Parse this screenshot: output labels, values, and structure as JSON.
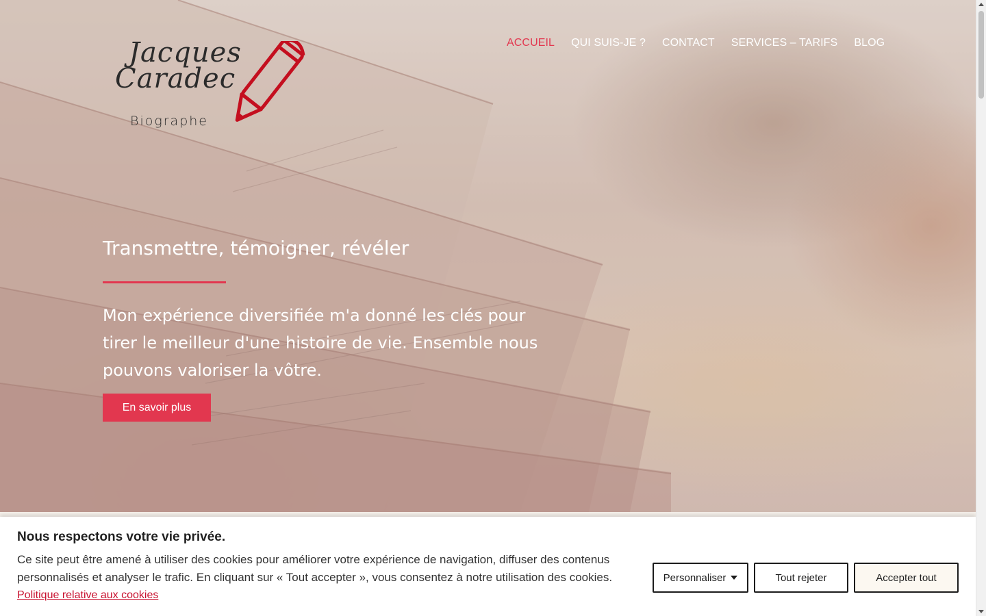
{
  "logo": {
    "script_line1": "Jacques",
    "script_line2": "Caradec",
    "subtitle": "Biographe",
    "icon": "pencil-icon"
  },
  "nav": {
    "items": [
      {
        "label": "ACCUEIL",
        "active": true
      },
      {
        "label": "QUI SUIS-JE ?",
        "active": false
      },
      {
        "label": "CONTACT",
        "active": false
      },
      {
        "label": "SERVICES – TARIFS",
        "active": false
      },
      {
        "label": "BLOG",
        "active": false
      }
    ]
  },
  "hero": {
    "tagline": "Transmettre, témoigner, révéler",
    "lead": "Mon expérience diversifiée m'a donné les clés pour tirer le meilleur d'une histoire de vie. Ensemble nous pouvons valoriser la vôtre.",
    "cta_label": "En savoir plus"
  },
  "cookie_banner": {
    "title": "Nous respectons votre vie privée.",
    "text": "Ce site peut être amené à utiliser des cookies pour améliorer votre expérience de navigation, diffuser des contenus personnalisés et analyser le trafic. En cliquant sur « Tout accepter », vous consentez à notre utilisation des cookies.",
    "policy_link": "Politique relative aux cookies",
    "customize_label": "Personnaliser",
    "reject_label": "Tout rejeter",
    "accept_label": "Accepter tout"
  },
  "colors": {
    "accent": "#e2374f",
    "pencil": "#c40f1f",
    "link": "#c8102e"
  }
}
